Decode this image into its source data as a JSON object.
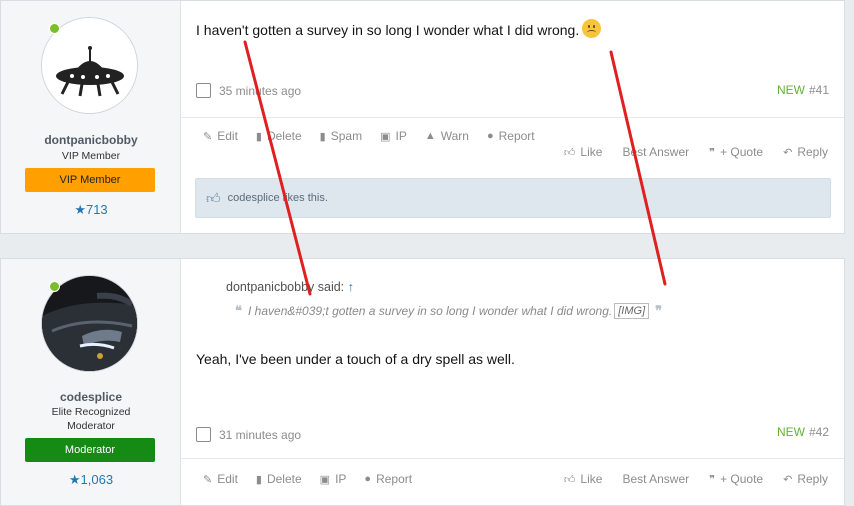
{
  "posts": [
    {
      "username": "dontpanicbobby",
      "user_title": "VIP Member",
      "badge": "VIP Member",
      "badge_color": "#ffa000",
      "reputation": "★713",
      "message": "I haven't gotten a survey in so long I wonder what I did wrong.",
      "time": "35 minutes ago",
      "new_label": "NEW",
      "post_number": "#41",
      "actions_left": [
        "Edit",
        "Delete",
        "Spam",
        "IP",
        "Warn",
        "Report"
      ],
      "actions_right": [
        "Like",
        "Best Answer",
        "+ Quote",
        "Reply"
      ],
      "likes_text": "codesplice likes this."
    },
    {
      "username": "codesplice",
      "user_title": "Elite Recognized Moderator",
      "badge": "Moderator",
      "badge_color": "#158a15",
      "reputation": "★1,063",
      "quote_author": "dontpanicbobby said:",
      "quote_arrow": "↑",
      "quote_text": "I haven&#039;t gotten a survey in so long I wonder what I did wrong.",
      "quote_img_alt": "[IMG]",
      "message": "Yeah, I've been under a touch of a dry spell as well.",
      "time": "31 minutes ago",
      "new_label": "NEW",
      "post_number": "#42",
      "actions_left": [
        "Edit",
        "Delete",
        "IP",
        "Report"
      ],
      "actions_right": [
        "Like",
        "Best Answer",
        "+ Quote",
        "Reply"
      ]
    }
  ],
  "colors": {
    "accent_blue": "#2577b1",
    "new_green": "#63b038",
    "online_green": "#7bbd2a",
    "annotation_red": "#e02020"
  },
  "icons": {
    "edit": "pencil-icon",
    "delete": "trash-icon",
    "spam": "spam-icon",
    "ip": "id-card-icon",
    "warn": "warning-icon",
    "report": "report-icon",
    "like": "thumbs-up-icon",
    "quote": "quote-icon",
    "reply": "reply-icon"
  }
}
